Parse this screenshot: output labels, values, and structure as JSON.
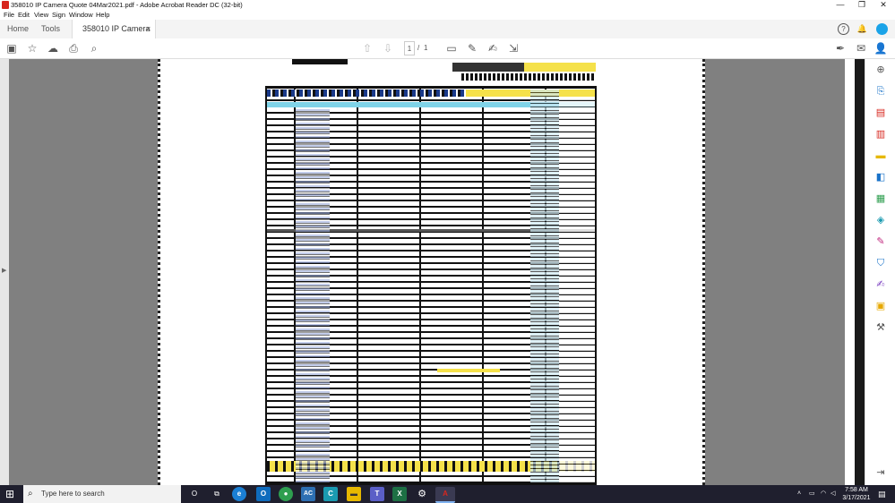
{
  "window": {
    "title": "358010 IP Camera  Quote 04Mar2021.pdf - Adobe Acrobat Reader DC (32-bit)",
    "minimize_icon": "minimize-icon",
    "maximize_icon": "restore-icon",
    "close_icon": "close-icon"
  },
  "menu": {
    "items": [
      "File",
      "Edit",
      "View",
      "Sign",
      "Window",
      "Help"
    ]
  },
  "tabs": {
    "home": "Home",
    "tools": "Tools",
    "document": "358010 IP Camera ...",
    "close": "×"
  },
  "toolbar": {
    "page_current": "1",
    "page_sep": "/",
    "page_total": "1"
  },
  "taskbar": {
    "search_placeholder": "Type here to search",
    "time": "7:58 AM",
    "date": "3/17/2021",
    "apps": [
      {
        "name": "cortana-icon",
        "label": "O"
      },
      {
        "name": "task-view-icon",
        "label": "⧉"
      },
      {
        "name": "edge-icon",
        "label": "e"
      },
      {
        "name": "outlook-icon",
        "label": "O"
      },
      {
        "name": "chrome-icon",
        "label": "●"
      },
      {
        "name": "acrobat-connect-icon",
        "label": "AC"
      },
      {
        "name": "cisco-icon",
        "label": "C"
      },
      {
        "name": "file-explorer-icon",
        "label": "▬"
      },
      {
        "name": "teams-icon",
        "label": "T"
      },
      {
        "name": "excel-icon",
        "label": "X"
      },
      {
        "name": "settings-icon",
        "label": "⚙"
      },
      {
        "name": "acrobat-reader-icon",
        "label": "A"
      }
    ]
  },
  "colors": {
    "acrobat_red": "#d7261e",
    "taskbar": "#1f1f2e",
    "viewer_bg": "#808080"
  }
}
